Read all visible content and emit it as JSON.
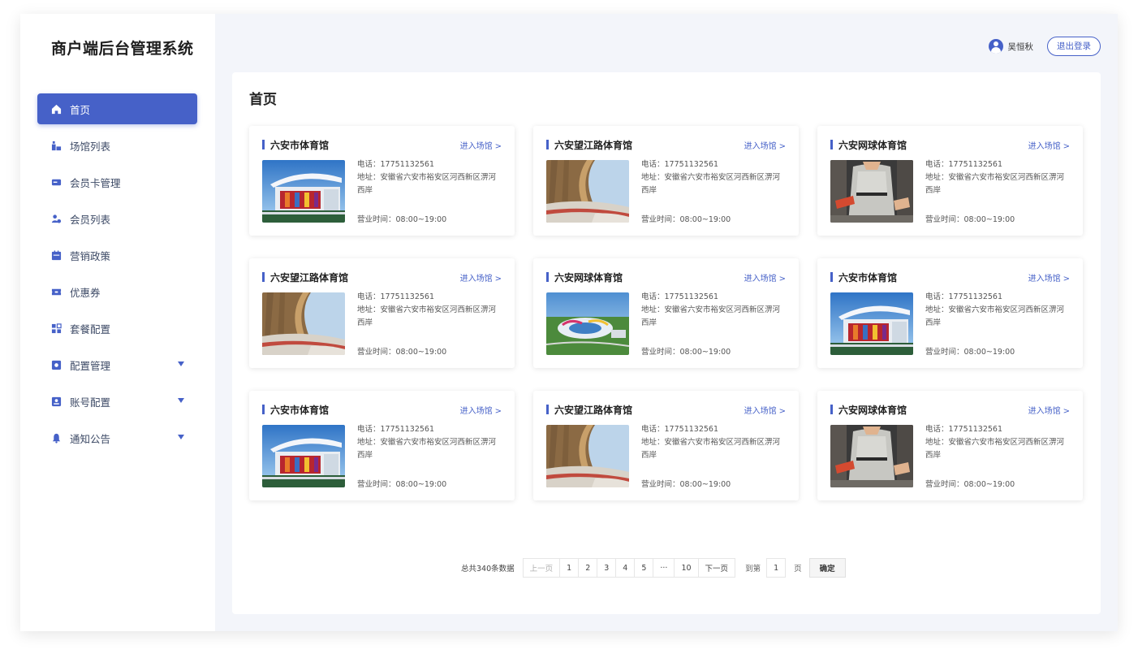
{
  "app": {
    "title": "商户端后台管理系统"
  },
  "colors": {
    "primary": "#4661c8",
    "background": "#f3f5fa"
  },
  "sidebar": {
    "items": [
      {
        "label": "首页",
        "icon": "home-icon",
        "active": true
      },
      {
        "label": "场馆列表",
        "icon": "venue-icon"
      },
      {
        "label": "会员卡管理",
        "icon": "vip-card-icon"
      },
      {
        "label": "会员列表",
        "icon": "members-icon"
      },
      {
        "label": "营销政策",
        "icon": "marketing-icon"
      },
      {
        "label": "优惠券",
        "icon": "coupon-icon"
      },
      {
        "label": "套餐配置",
        "icon": "package-icon"
      },
      {
        "label": "配置管理",
        "icon": "settings-icon",
        "expandable": true
      },
      {
        "label": "账号配置",
        "icon": "account-icon",
        "expandable": true
      },
      {
        "label": "通知公告",
        "icon": "bell-icon",
        "expandable": true
      }
    ]
  },
  "header": {
    "username": "吴恒秋",
    "logout": "退出登录"
  },
  "main": {
    "title": "首页"
  },
  "card_labels": {
    "enter": "进入场馆",
    "phone_prefix": "电话：",
    "address_prefix": "地址：",
    "hours_prefix": "营业时间："
  },
  "venues": [
    {
      "name": "六安市体育馆",
      "phone": "17751132561",
      "address": "安徽省六安市裕安区河西新区淠河西岸",
      "hours": "08:00~19:00",
      "photo": "arena"
    },
    {
      "name": "六安望江路体育馆",
      "phone": "17751132561",
      "address": "安徽省六安市裕安区河西新区淠河西岸",
      "hours": "08:00~19:00",
      "photo": "stadium"
    },
    {
      "name": "六安网球体育馆",
      "phone": "17751132561",
      "address": "安徽省六安市裕安区河西新区淠河西岸",
      "hours": "08:00~19:00",
      "photo": "player"
    },
    {
      "name": "六安望江路体育馆",
      "phone": "17751132561",
      "address": "安徽省六安市裕安区河西新区淠河西岸",
      "hours": "08:00~19:00",
      "photo": "stadium"
    },
    {
      "name": "六安网球体育馆",
      "phone": "17751132561",
      "address": "安徽省六安市裕安区河西新区淠河西岸",
      "hours": "08:00~19:00",
      "photo": "aerial"
    },
    {
      "name": "六安市体育馆",
      "phone": "17751132561",
      "address": "安徽省六安市裕安区河西新区淠河西岸",
      "hours": "08:00~19:00",
      "photo": "arena"
    },
    {
      "name": "六安市体育馆",
      "phone": "17751132561",
      "address": "安徽省六安市裕安区河西新区淠河西岸",
      "hours": "08:00~19:00",
      "photo": "arena"
    },
    {
      "name": "六安望江路体育馆",
      "phone": "17751132561",
      "address": "安徽省六安市裕安区河西新区淠河西岸",
      "hours": "08:00~19:00",
      "photo": "stadium"
    },
    {
      "name": "六安网球体育馆",
      "phone": "17751132561",
      "address": "安徽省六安市裕安区河西新区淠河西岸",
      "hours": "08:00~19:00",
      "photo": "player"
    }
  ],
  "pagination": {
    "total": "总共340条数据",
    "prev": "上一页",
    "pages": [
      "1",
      "2",
      "3",
      "4",
      "5",
      "···",
      "10"
    ],
    "next": "下一页",
    "goto": "到第",
    "current": "1",
    "unit": "页",
    "confirm": "确定"
  }
}
